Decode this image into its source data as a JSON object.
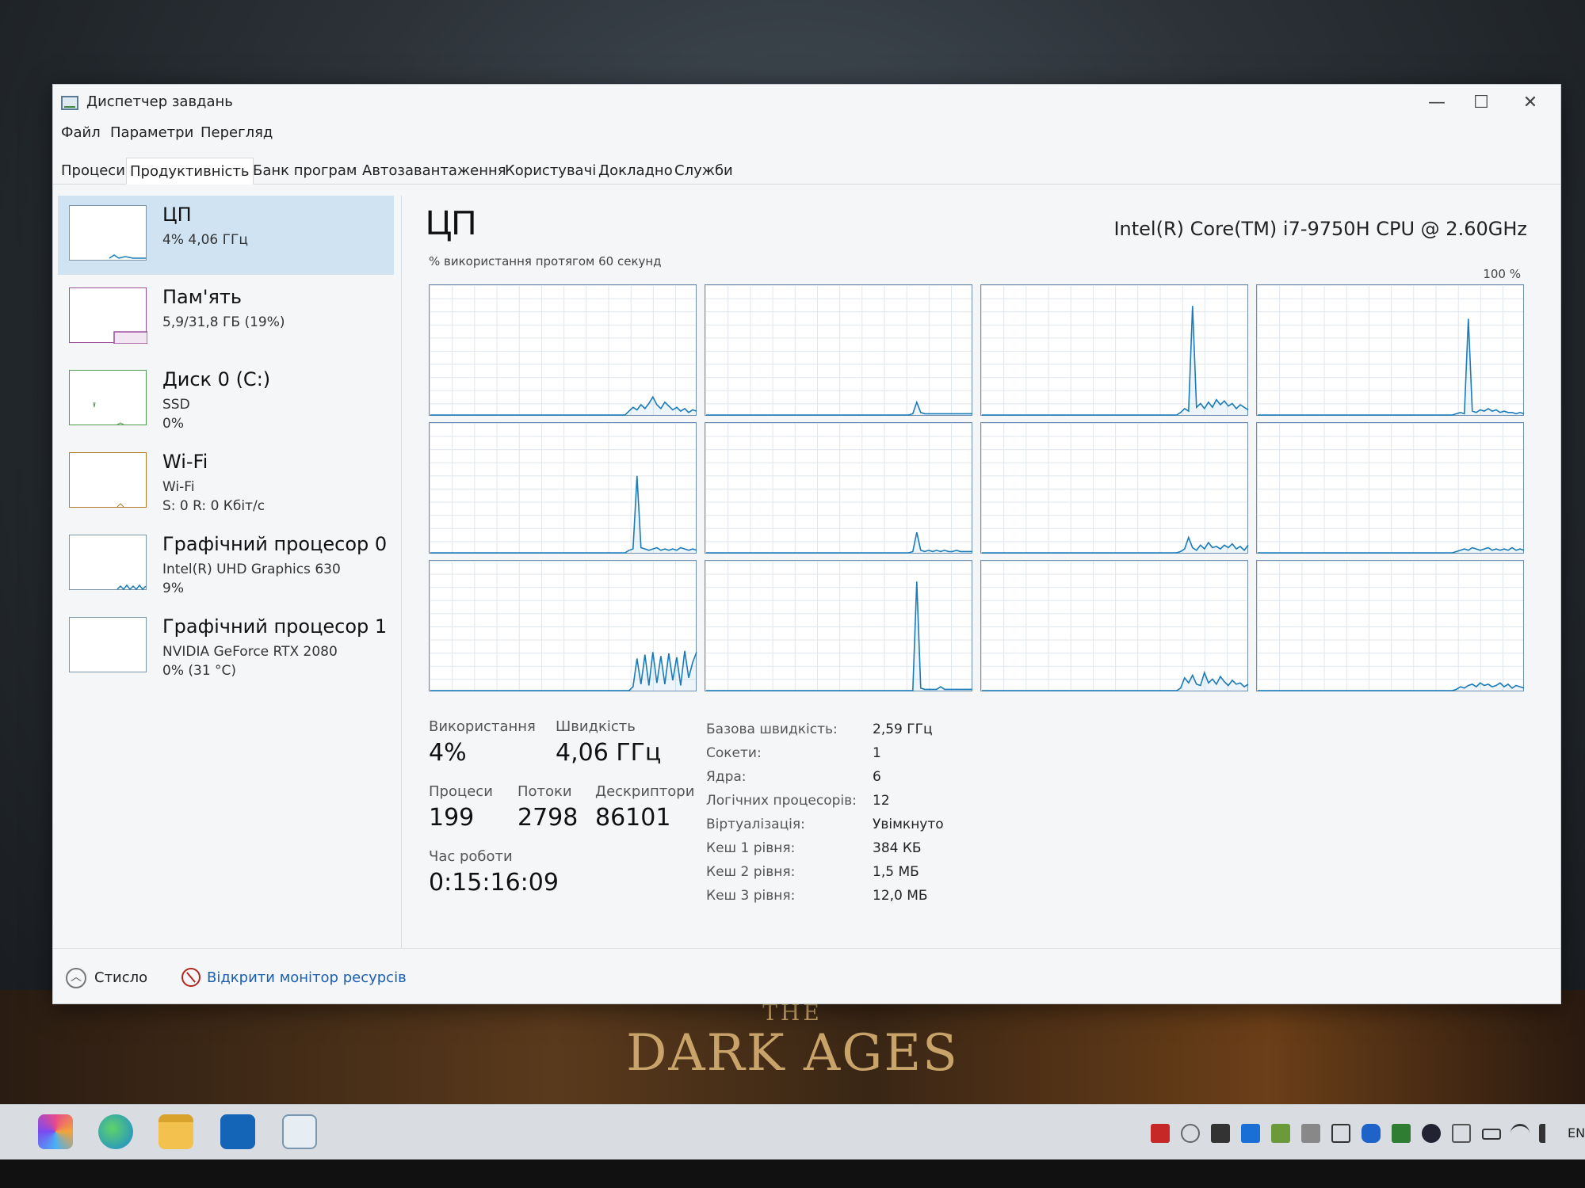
{
  "window": {
    "title": "Диспетчер завдань",
    "minimize": "—",
    "maximize": "☐",
    "close": "✕"
  },
  "menu": [
    "Файл",
    "Параметри",
    "Перегляд"
  ],
  "tabs": [
    {
      "label": "Процеси",
      "active": false
    },
    {
      "label": "Продуктивність",
      "active": true
    },
    {
      "label": "Банк програм",
      "active": false
    },
    {
      "label": "Автозавантаження",
      "active": false
    },
    {
      "label": "Користувачі",
      "active": false
    },
    {
      "label": "Докладно",
      "active": false
    },
    {
      "label": "Служби",
      "active": false
    }
  ],
  "sidebar": [
    {
      "name": "ЦП",
      "sub1": "4% 4,06 ГГц",
      "sub2": "",
      "icon": "cpu-graph-icon"
    },
    {
      "name": "Пам'ять",
      "sub1": "5,9/31,8 ГБ (19%)",
      "sub2": "",
      "icon": "memory-graph-icon"
    },
    {
      "name": "Диск 0 (C:)",
      "sub1": "SSD",
      "sub2": "0%",
      "icon": "disk-graph-icon"
    },
    {
      "name": "Wi-Fi",
      "sub1": "Wi-Fi",
      "sub2": "S: 0 R: 0 Кбіт/с",
      "icon": "wifi-graph-icon"
    },
    {
      "name": "Графічний процесор 0",
      "sub1": "Intel(R) UHD Graphics 630",
      "sub2": "9%",
      "icon": "gpu0-graph-icon"
    },
    {
      "name": "Графічний процесор 1",
      "sub1": "NVIDIA GeForce RTX 2080",
      "sub2": "0% (31 °C)",
      "icon": "gpu1-graph-icon"
    }
  ],
  "main": {
    "title": "ЦП",
    "cpu_model": "Intel(R) Core(TM) i7-9750H CPU @ 2.60GHz",
    "graph_caption": "% використання протягом 60 секунд",
    "graph_max": "100 %",
    "stats": {
      "usage_label": "Використання",
      "usage": "4%",
      "speed_label": "Швидкість",
      "speed": "4,06 ГГц",
      "processes_label": "Процеси",
      "processes": "199",
      "threads_label": "Потоки",
      "threads": "2798",
      "handles_label": "Дескриптори",
      "handles": "86101",
      "uptime_label": "Час роботи",
      "uptime": "0:15:16:09"
    },
    "details": [
      {
        "label": "Базова швидкість:",
        "value": "2,59 ГГц"
      },
      {
        "label": "Сокети:",
        "value": "1"
      },
      {
        "label": "Ядра:",
        "value": "6"
      },
      {
        "label": "Логічних процесорів:",
        "value": "12"
      },
      {
        "label": "Віртуалізація:",
        "value": "Увімкнуто"
      },
      {
        "label": "Кеш 1 рівня:",
        "value": "384 КБ"
      },
      {
        "label": "Кеш 2 рівня:",
        "value": "1,5 МБ"
      },
      {
        "label": "Кеш 3 рівня:",
        "value": "12,0 МБ"
      }
    ]
  },
  "core_usage": [
    [
      0,
      0,
      0,
      0,
      0,
      0,
      0,
      0,
      0,
      0,
      0,
      0,
      0,
      0,
      0,
      0,
      0,
      0,
      0,
      0,
      0,
      0,
      0,
      0,
      0,
      0,
      0,
      0,
      0,
      0,
      0,
      0,
      0,
      0,
      0,
      0,
      0,
      0,
      0,
      0,
      0,
      0,
      0,
      0,
      0,
      0,
      0,
      0,
      0,
      0,
      3,
      6,
      4,
      8,
      5,
      9,
      14,
      8,
      5,
      10,
      7,
      4,
      6,
      3,
      5,
      2,
      4,
      3
    ],
    [
      0,
      0,
      0,
      0,
      0,
      0,
      0,
      0,
      0,
      0,
      0,
      0,
      0,
      0,
      0,
      0,
      0,
      0,
      0,
      0,
      0,
      0,
      0,
      0,
      0,
      0,
      0,
      0,
      0,
      0,
      0,
      0,
      0,
      0,
      0,
      0,
      0,
      0,
      0,
      0,
      0,
      0,
      0,
      0,
      0,
      0,
      0,
      0,
      0,
      0,
      0,
      0,
      1,
      10,
      2,
      1,
      1,
      1,
      1,
      1,
      1,
      1,
      1,
      1,
      1,
      1,
      1,
      1
    ],
    [
      0,
      0,
      0,
      0,
      0,
      0,
      0,
      0,
      0,
      0,
      0,
      0,
      0,
      0,
      0,
      0,
      0,
      0,
      0,
      0,
      0,
      0,
      0,
      0,
      0,
      0,
      0,
      0,
      0,
      0,
      0,
      0,
      0,
      0,
      0,
      0,
      0,
      0,
      0,
      0,
      0,
      0,
      0,
      0,
      0,
      0,
      0,
      0,
      0,
      0,
      2,
      5,
      3,
      85,
      6,
      9,
      5,
      10,
      6,
      12,
      8,
      11,
      7,
      9,
      5,
      8,
      6,
      4
    ],
    [
      0,
      0,
      0,
      0,
      0,
      0,
      0,
      0,
      0,
      0,
      0,
      0,
      0,
      0,
      0,
      0,
      0,
      0,
      0,
      0,
      0,
      0,
      0,
      0,
      0,
      0,
      0,
      0,
      0,
      0,
      0,
      0,
      0,
      0,
      0,
      0,
      0,
      0,
      0,
      0,
      0,
      0,
      0,
      0,
      0,
      0,
      0,
      0,
      0,
      0,
      1,
      2,
      1,
      75,
      3,
      2,
      4,
      3,
      5,
      3,
      4,
      2,
      3,
      2,
      2,
      1,
      2,
      1
    ],
    [
      0,
      0,
      0,
      0,
      0,
      0,
      0,
      0,
      0,
      0,
      0,
      0,
      0,
      0,
      0,
      0,
      0,
      0,
      0,
      0,
      0,
      0,
      0,
      0,
      0,
      0,
      0,
      0,
      0,
      0,
      0,
      0,
      0,
      0,
      0,
      0,
      0,
      0,
      0,
      0,
      0,
      0,
      0,
      0,
      0,
      0,
      0,
      0,
      0,
      0,
      2,
      3,
      60,
      4,
      3,
      2,
      3,
      4,
      2,
      3,
      2,
      3,
      2,
      4,
      3,
      2,
      3,
      2
    ],
    [
      0,
      0,
      0,
      0,
      0,
      0,
      0,
      0,
      0,
      0,
      0,
      0,
      0,
      0,
      0,
      0,
      0,
      0,
      0,
      0,
      0,
      0,
      0,
      0,
      0,
      0,
      0,
      0,
      0,
      0,
      0,
      0,
      0,
      0,
      0,
      0,
      0,
      0,
      0,
      0,
      0,
      0,
      0,
      0,
      0,
      0,
      0,
      0,
      0,
      0,
      0,
      0,
      1,
      16,
      2,
      1,
      2,
      1,
      2,
      1,
      2,
      1,
      1,
      2,
      1,
      1,
      1,
      1
    ],
    [
      0,
      0,
      0,
      0,
      0,
      0,
      0,
      0,
      0,
      0,
      0,
      0,
      0,
      0,
      0,
      0,
      0,
      0,
      0,
      0,
      0,
      0,
      0,
      0,
      0,
      0,
      0,
      0,
      0,
      0,
      0,
      0,
      0,
      0,
      0,
      0,
      0,
      0,
      0,
      0,
      0,
      0,
      0,
      0,
      0,
      0,
      0,
      0,
      0,
      0,
      1,
      3,
      12,
      4,
      2,
      6,
      3,
      8,
      4,
      5,
      3,
      6,
      4,
      7,
      3,
      5,
      2,
      6
    ],
    [
      0,
      0,
      0,
      0,
      0,
      0,
      0,
      0,
      0,
      0,
      0,
      0,
      0,
      0,
      0,
      0,
      0,
      0,
      0,
      0,
      0,
      0,
      0,
      0,
      0,
      0,
      0,
      0,
      0,
      0,
      0,
      0,
      0,
      0,
      0,
      0,
      0,
      0,
      0,
      0,
      0,
      0,
      0,
      0,
      0,
      0,
      0,
      0,
      0,
      0,
      1,
      2,
      3,
      2,
      4,
      3,
      2,
      3,
      4,
      2,
      3,
      2,
      3,
      2,
      4,
      2,
      3,
      2
    ],
    [
      0,
      0,
      0,
      0,
      0,
      0,
      0,
      0,
      0,
      0,
      0,
      0,
      0,
      0,
      0,
      0,
      0,
      0,
      0,
      0,
      0,
      0,
      0,
      0,
      0,
      0,
      0,
      0,
      0,
      0,
      0,
      0,
      0,
      0,
      0,
      0,
      0,
      0,
      0,
      0,
      0,
      0,
      0,
      0,
      0,
      0,
      0,
      0,
      0,
      0,
      0,
      3,
      25,
      5,
      28,
      4,
      30,
      6,
      27,
      5,
      29,
      8,
      26,
      4,
      31,
      10,
      22,
      30
    ],
    [
      0,
      0,
      0,
      0,
      0,
      0,
      0,
      0,
      0,
      0,
      0,
      0,
      0,
      0,
      0,
      0,
      0,
      0,
      0,
      0,
      0,
      0,
      0,
      0,
      0,
      0,
      0,
      0,
      0,
      0,
      0,
      0,
      0,
      0,
      0,
      0,
      0,
      0,
      0,
      0,
      0,
      0,
      0,
      0,
      0,
      0,
      0,
      0,
      0,
      0,
      0,
      0,
      0,
      85,
      2,
      1,
      1,
      1,
      1,
      3,
      1,
      1,
      1,
      1,
      1,
      1,
      1,
      1
    ],
    [
      0,
      0,
      0,
      0,
      0,
      0,
      0,
      0,
      0,
      0,
      0,
      0,
      0,
      0,
      0,
      0,
      0,
      0,
      0,
      0,
      0,
      0,
      0,
      0,
      0,
      0,
      0,
      0,
      0,
      0,
      0,
      0,
      0,
      0,
      0,
      0,
      0,
      0,
      0,
      0,
      0,
      0,
      0,
      0,
      0,
      0,
      0,
      0,
      0,
      0,
      2,
      10,
      6,
      12,
      5,
      4,
      14,
      6,
      9,
      5,
      11,
      7,
      4,
      8,
      5,
      6,
      3,
      5
    ],
    [
      0,
      0,
      0,
      0,
      0,
      0,
      0,
      0,
      0,
      0,
      0,
      0,
      0,
      0,
      0,
      0,
      0,
      0,
      0,
      0,
      0,
      0,
      0,
      0,
      0,
      0,
      0,
      0,
      0,
      0,
      0,
      0,
      0,
      0,
      0,
      0,
      0,
      0,
      0,
      0,
      0,
      0,
      0,
      0,
      0,
      0,
      0,
      0,
      0,
      0,
      1,
      3,
      2,
      4,
      5,
      3,
      6,
      4,
      5,
      3,
      4,
      6,
      3,
      5,
      2,
      4,
      3,
      2
    ]
  ],
  "footer": {
    "fewer_label": "Стисло",
    "resmon_link": "Відкрити монітор ресурсів"
  },
  "wallpaper": {
    "line1": "THE",
    "line2": "DARK AGES"
  },
  "taskbar": {
    "apps": [
      "copilot-icon",
      "edge-icon",
      "file-explorer-icon",
      "outlook-icon",
      "task-manager-icon"
    ],
    "tray": [
      "app-tray-icon",
      "settings-tray-icon",
      "notion-tray-icon",
      "k-tray-icon",
      "gpu-tray-icon",
      "monitor-tray-icon",
      "security-tray-icon",
      "bluetooth-tray-icon",
      "nvidia-tray-icon",
      "steam-tray-icon",
      "webcam-tray-icon",
      "battery-icon",
      "wifi-icon",
      "volume-icon"
    ],
    "lang": "EN"
  }
}
